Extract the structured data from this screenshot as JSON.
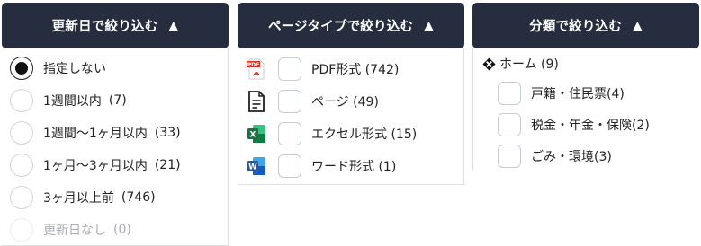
{
  "update_filter": {
    "header": "更新日で絞り込む",
    "header_icon": "triangle-up",
    "options": [
      {
        "label": "指定しない",
        "count": "",
        "selected": true,
        "disabled": false
      },
      {
        "label": "1週間以内",
        "count": "(7)",
        "selected": false,
        "disabled": false
      },
      {
        "label": "1週間〜1ヶ月以内",
        "count": "(33)",
        "selected": false,
        "disabled": false
      },
      {
        "label": "1ヶ月〜3ヶ月以内",
        "count": "(21)",
        "selected": false,
        "disabled": false
      },
      {
        "label": "3ヶ月以上前",
        "count": "(746)",
        "selected": false,
        "disabled": false
      },
      {
        "label": "更新日なし",
        "count": "(0)",
        "selected": false,
        "disabled": true
      }
    ]
  },
  "type_filter": {
    "header": "ページタイプで絞り込む",
    "header_icon": "triangle-up",
    "options": [
      {
        "icon": "pdf-icon",
        "label": "PDF形式 (742)"
      },
      {
        "icon": "page-document-icon",
        "label": "ページ (49)"
      },
      {
        "icon": "excel-icon",
        "label": "エクセル形式 (15)"
      },
      {
        "icon": "word-icon",
        "label": "ワード形式 (1)"
      }
    ]
  },
  "category_filter": {
    "header": "分類で絞り込む",
    "header_icon": "triangle-up",
    "root": {
      "icon": "diamond-cross-icon",
      "label": "ホーム (9)"
    },
    "options": [
      {
        "label": "戸籍・住民票(4)"
      },
      {
        "label": "税金・年金・保険(2)"
      },
      {
        "label": "ごみ・環境(3)"
      }
    ]
  },
  "colors": {
    "header_bg": "#262d3f",
    "header_text": "#ffffff",
    "pdf_red": "#d93025",
    "excel_green": "#1e7145",
    "word_blue": "#2b579a"
  }
}
